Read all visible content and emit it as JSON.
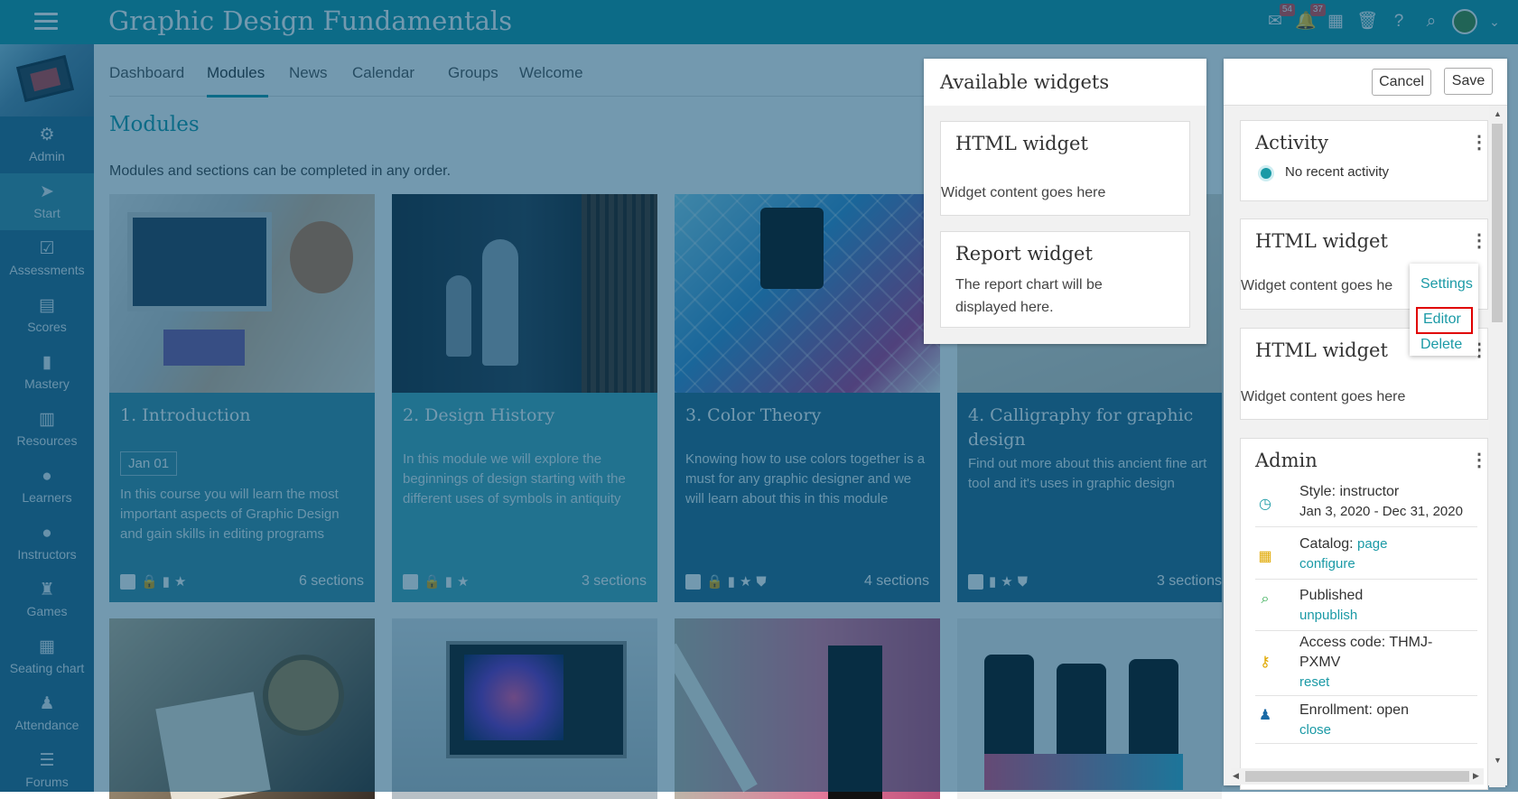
{
  "app": {
    "title": "Graphic Design Fundamentals",
    "badge_messages": "54",
    "badge_notifications": "37"
  },
  "sidebar": {
    "items": [
      {
        "label": "Admin",
        "icon": "⚙"
      },
      {
        "label": "Start",
        "icon": "➤"
      },
      {
        "label": "Assessments",
        "icon": "☑"
      },
      {
        "label": "Scores",
        "icon": "▤"
      },
      {
        "label": "Mastery",
        "icon": "▮"
      },
      {
        "label": "Resources",
        "icon": "▥"
      },
      {
        "label": "Learners",
        "icon": "●"
      },
      {
        "label": "Instructors",
        "icon": "●"
      },
      {
        "label": "Games",
        "icon": "♜"
      },
      {
        "label": "Seating chart",
        "icon": "▦"
      },
      {
        "label": "Attendance",
        "icon": "♟"
      },
      {
        "label": "Forums",
        "icon": "☰"
      }
    ]
  },
  "tabs": [
    "Dashboard",
    "Modules",
    "News",
    "Calendar",
    "Groups",
    "Welcome"
  ],
  "page": {
    "title": "Modules",
    "description": "Modules and sections can be completed in any order."
  },
  "modules": [
    {
      "title": "1. Introduction",
      "date": "Jan 01",
      "desc": "In this course you will learn the most important aspects of Graphic Design and gain skills in editing programs",
      "sections": "6 sections"
    },
    {
      "title": "2. Design History",
      "desc": "In this module we will explore the beginnings of design starting with the different uses of symbols in antiquity",
      "sections": "3 sections"
    },
    {
      "title": "3. Color Theory",
      "desc": "Knowing how to use colors together is a must for any graphic designer and we will learn about this in this module",
      "sections": "4 sections"
    },
    {
      "title": "4. Calligraphy for graphic design",
      "desc": "Find out more about this ancient fine art tool and it's uses in graphic design",
      "sections": "3 sections"
    }
  ],
  "available_widgets": {
    "title": "Available widgets",
    "html": {
      "title": "HTML widget",
      "content": "Widget content goes here"
    },
    "report": {
      "title": "Report widget",
      "content": "The report chart will be displayed here."
    }
  },
  "editor": {
    "cancel": "Cancel",
    "save": "Save",
    "activity": {
      "title": "Activity",
      "text": "No recent activity"
    },
    "html1": {
      "title": "HTML widget",
      "content": "Widget content goes he"
    },
    "menu": {
      "settings": "Settings",
      "editor": "Editor",
      "delete": "Delete"
    },
    "html2": {
      "title": "HTML widget",
      "content": "Widget content goes here"
    },
    "admin": {
      "title": "Admin",
      "style": "Style: instructor",
      "dates": "Jan 3, 2020 - Dec 31, 2020",
      "catalog": "Catalog:",
      "catalog_link": "page",
      "catalog_configure": "configure",
      "published": "Published",
      "unpublish": "unpublish",
      "access": "Access code: THMJ-PXMV",
      "reset": "reset",
      "enrollment": "Enrollment: open",
      "close": "close"
    }
  },
  "colors": {
    "accent": "#1b9aa6",
    "sidebar": "#2c6b8c",
    "highlight": "#e00000"
  }
}
